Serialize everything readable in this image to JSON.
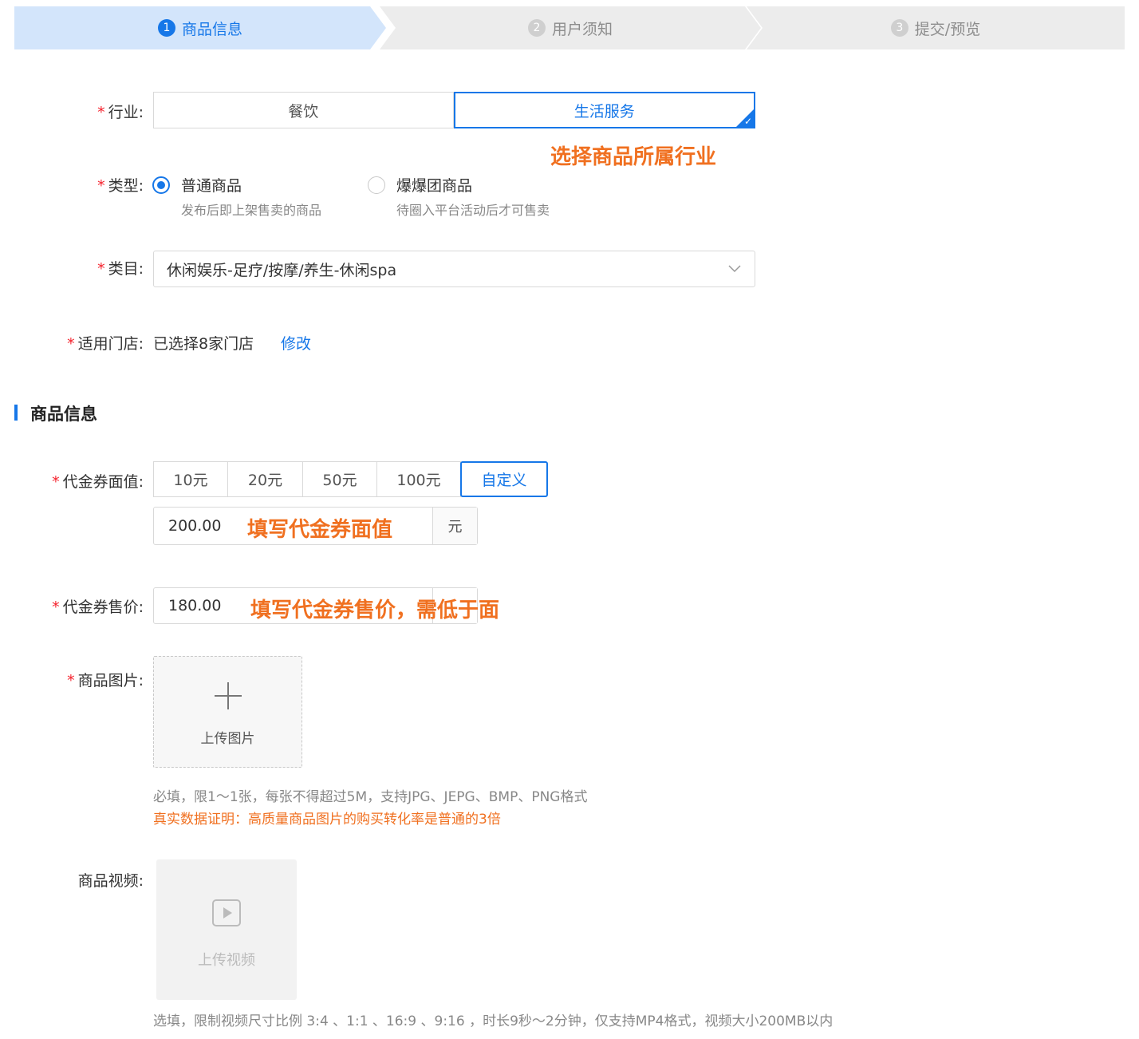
{
  "steps": [
    {
      "num": "1",
      "label": "商品信息"
    },
    {
      "num": "2",
      "label": "用户须知"
    },
    {
      "num": "3",
      "label": "提交/预览"
    }
  ],
  "industry": {
    "label": "行业:",
    "options": [
      "餐饮",
      "生活服务"
    ],
    "selected": "生活服务",
    "annotation": "选择商品所属行业"
  },
  "type": {
    "label": "类型:",
    "options": [
      {
        "title": "普通商品",
        "desc": "发布后即上架售卖的商品"
      },
      {
        "title": "爆爆团商品",
        "desc": "待圈入平台活动后才可售卖"
      }
    ]
  },
  "category": {
    "label": "类目:",
    "value": "休闲娱乐-足疗/按摩/养生-休闲spa"
  },
  "stores": {
    "label": "适用门店:",
    "value": "已选择8家门店",
    "edit_link": "修改"
  },
  "section": {
    "title": "商品信息"
  },
  "voucher_value": {
    "label": "代金券面值:",
    "options": [
      "10元",
      "20元",
      "50元",
      "100元",
      "自定义"
    ],
    "selected": "自定义",
    "input_value": "200.00",
    "unit": "元",
    "annotation": "填写代金券面值"
  },
  "voucher_price": {
    "label": "代金券售价:",
    "input_value": "180.00",
    "annotation": "填写代金券售价，需低于面"
  },
  "product_image": {
    "label": "商品图片:",
    "upload_text": "上传图片",
    "hint": "必填，限1～1张，每张不得超过5M，支持JPG、JEPG、BMP、PNG格式",
    "hint_highlight": "真实数据证明：高质量商品图片的购买转化率是普通的3倍"
  },
  "product_video": {
    "label": "商品视频:",
    "upload_text": "上传视频",
    "hint": "选填，限制视频尺寸比例 3:4 、1:1 、16:9 、9:16 ，时长9秒～2分钟，仅支持MP4格式，视频大小200MB以内"
  },
  "required_mark": "*",
  "colors": {
    "primary": "#1677e8",
    "annotation": "#f07020",
    "required": "#f5222d"
  }
}
